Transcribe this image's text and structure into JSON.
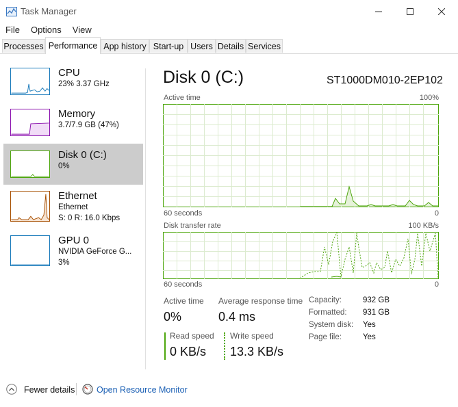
{
  "window": {
    "title": "Task Manager",
    "controls": {
      "minimize": "—",
      "maximize": "☐",
      "close": "✕"
    }
  },
  "menu": [
    "File",
    "Options",
    "View"
  ],
  "tabs": [
    "Processes",
    "Performance",
    "App history",
    "Start-up",
    "Users",
    "Details",
    "Services"
  ],
  "active_tab": "Performance",
  "sidebar": {
    "items": [
      {
        "title": "CPU",
        "sub1": "23%  3.37 GHz",
        "sub2": "",
        "color": "#1779ba"
      },
      {
        "title": "Memory",
        "sub1": "3.7/7.9 GB (47%)",
        "sub2": "",
        "color": "#8b12ae"
      },
      {
        "title": "Disk 0 (C:)",
        "sub1": "0%",
        "sub2": "",
        "color": "#4da60c"
      },
      {
        "title": "Ethernet",
        "sub1": "Ethernet",
        "sub2": "S: 0  R: 16.0 Kbps",
        "color": "#a74f01"
      },
      {
        "title": "GPU 0",
        "sub1": "NVIDIA GeForce G...",
        "sub2": "3%",
        "color": "#1779ba"
      }
    ],
    "selected": "Disk 0 (C:)"
  },
  "main": {
    "title": "Disk 0 (C:)",
    "device": "ST1000DM010-2EP102",
    "graph1": {
      "label": "Active time",
      "max": "100%",
      "time": "60 seconds",
      "min": "0"
    },
    "graph2": {
      "label": "Disk transfer rate",
      "max": "100 KB/s",
      "time": "60 seconds",
      "min": "0"
    },
    "stats": {
      "active_time_label": "Active time",
      "active_time_value": "0%",
      "avg_resp_label": "Average response time",
      "avg_resp_value": "0.4 ms",
      "read_label": "Read speed",
      "read_value": "0 KB/s",
      "write_label": "Write speed",
      "write_value": "13.3 KB/s"
    },
    "properties": [
      {
        "key": "Capacity:",
        "value": "932 GB"
      },
      {
        "key": "Formatted:",
        "value": "931 GB"
      },
      {
        "key": "System disk:",
        "value": "Yes"
      },
      {
        "key": "Page file:",
        "value": "Yes"
      }
    ]
  },
  "footer": {
    "fewer_details": "Fewer details",
    "open_resource_monitor": "Open Resource Monitor"
  },
  "colors": {
    "disk": "#4da60c",
    "link": "#1a5fb4",
    "selected": "#cccccc"
  }
}
